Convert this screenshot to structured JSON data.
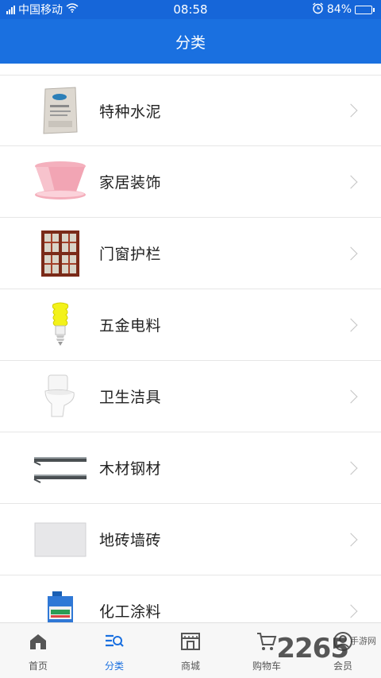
{
  "status_bar": {
    "carrier": "中国移动",
    "time": "08:58",
    "battery": "84%",
    "battery_level": 0.84,
    "icons": [
      "signal-icon",
      "wifi-icon",
      "alarm-icon",
      "battery-icon"
    ]
  },
  "header": {
    "title": "分类"
  },
  "categories": [
    {
      "label": "特种水泥",
      "icon": "cement-bag-icon"
    },
    {
      "label": "家居装饰",
      "icon": "flower-pot-icon"
    },
    {
      "label": "门窗护栏",
      "icon": "window-frame-icon"
    },
    {
      "label": "五金电料",
      "icon": "light-bulb-icon"
    },
    {
      "label": "卫生洁具",
      "icon": "toilet-icon"
    },
    {
      "label": "木材钢材",
      "icon": "steel-bar-icon"
    },
    {
      "label": "地砖墙砖",
      "icon": "tile-icon"
    },
    {
      "label": "化工涂料",
      "icon": "paint-bucket-icon"
    }
  ],
  "tabs": [
    {
      "label": "首页",
      "icon": "home-icon",
      "active": false
    },
    {
      "label": "分类",
      "icon": "category-icon",
      "active": true
    },
    {
      "label": "商城",
      "icon": "store-icon",
      "active": false
    },
    {
      "label": "购物车",
      "icon": "cart-icon",
      "active": false
    },
    {
      "label": "会员",
      "icon": "user-icon",
      "active": false
    }
  ],
  "watermark": {
    "big": "2265",
    "small": "手游网"
  },
  "colors": {
    "primary": "#1a70e0",
    "status_bar": "#1666d9",
    "divider": "#e6e6e6"
  }
}
